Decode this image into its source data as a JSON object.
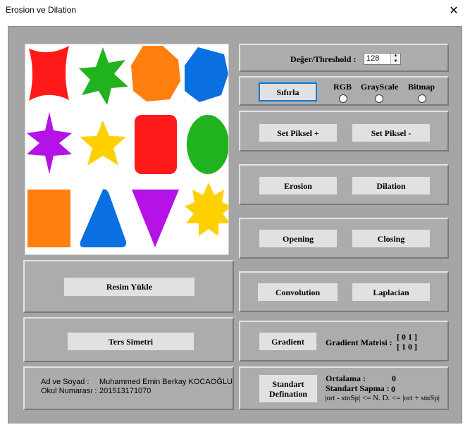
{
  "window": {
    "title": "Erosion ve Dilation",
    "close_glyph": "✕"
  },
  "threshold": {
    "label": "Değer/Threshold :",
    "value": "128",
    "up_glyph": "▲",
    "down_glyph": "▼"
  },
  "mode": {
    "reset_label": "Sıfırla",
    "options": [
      "RGB",
      "GrayScale",
      "Bitmap"
    ]
  },
  "pixel": {
    "plus_label": "Set Piksel +",
    "minus_label": "Set Piksel -"
  },
  "morph": {
    "erosion_label": "Erosion",
    "dilation_label": "Dilation",
    "opening_label": "Opening",
    "closing_label": "Closing"
  },
  "filters": {
    "convolution_label": "Convolution",
    "laplacian_label": "Laplacian"
  },
  "gradient": {
    "button_label": "Gradient",
    "matrix_label": "Gradient Matrisi :",
    "matrix_row1": "[ 0  1 ]",
    "matrix_row2": "[ 1  0 ]"
  },
  "stats": {
    "button_line1": "Standart",
    "button_line2": "Defination",
    "mean_label": "Ortalama :",
    "mean_value": "0",
    "std_label": "Standart Sapma :",
    "std_value": "0",
    "range_text": "|ort - stnSp| <= N. D. <= |ort + stnSp|"
  },
  "image": {
    "load_label": "Resim Yükle",
    "mirror_label": "Ters Simetri"
  },
  "student": {
    "name_label": "Ad ve Soyad :",
    "name_value": "Muhammed Emin Berkay KOCAOĞLU",
    "number_label": "Okul Numarası :",
    "number_value": "201513171070"
  },
  "shape_colors": {
    "red": "#ff1a1a",
    "green": "#21b21f",
    "orange": "#ff7f0e",
    "blue": "#0a6fe0",
    "purple": "#b412e6",
    "yellow": "#ffd000"
  }
}
